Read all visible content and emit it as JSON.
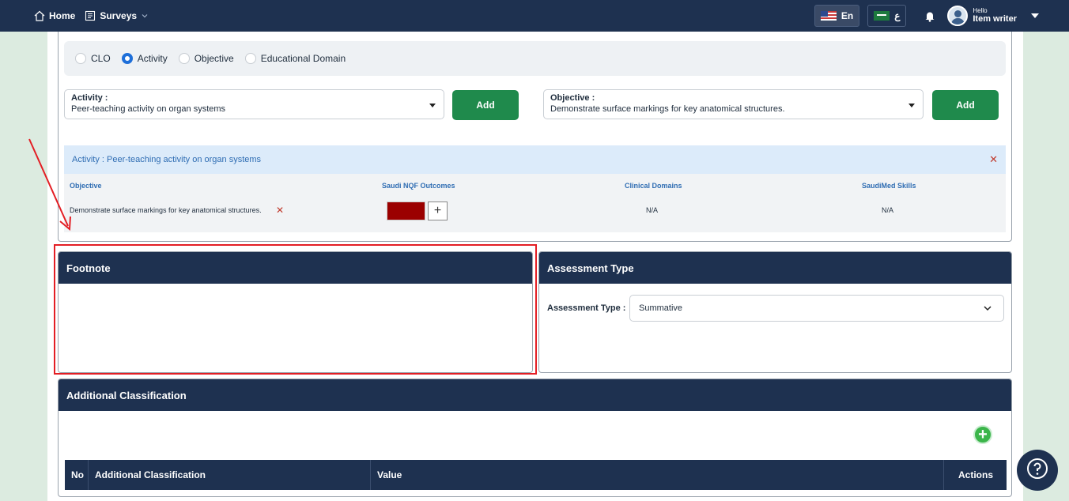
{
  "nav": {
    "home": "Home",
    "surveys": "Surveys",
    "lang_en": "En",
    "lang_ar": "ع",
    "user_greeting": "Hello",
    "user_name": "Item writer"
  },
  "radios": [
    {
      "label": "CLO",
      "checked": false
    },
    {
      "label": "Activity",
      "checked": true
    },
    {
      "label": "Objective",
      "checked": false
    },
    {
      "label": "Educational Domain",
      "checked": false
    }
  ],
  "activity_select": {
    "label": "Activity :",
    "value": "Peer-teaching activity on organ systems",
    "add": "Add"
  },
  "objective_select": {
    "label": "Objective :",
    "value": "Demonstrate surface markings for key anatomical structures.",
    "add": "Add"
  },
  "activity_banner": "Activity : Peer-teaching activity on organ systems",
  "mapping": {
    "headers": [
      "Objective",
      "Saudi NQF Outcomes",
      "Clinical Domains",
      "SaudiMed Skills"
    ],
    "row": {
      "objective": "Demonstrate surface markings for key anatomical structures.",
      "nqf_color": "#9b0000",
      "clinical": "N/A",
      "saudimed": "N/A"
    }
  },
  "footnote": {
    "title": "Footnote",
    "value": ""
  },
  "assessment": {
    "title": "Assessment Type",
    "label": "Assessment Type :",
    "value": "Summative"
  },
  "additional": {
    "title": "Additional Classification",
    "columns": [
      "No",
      "Additional Classification",
      "Value",
      "Actions"
    ]
  },
  "colors": {
    "navy": "#1e3150",
    "green": "#1f8a4c",
    "annotation": "#e31e24"
  }
}
